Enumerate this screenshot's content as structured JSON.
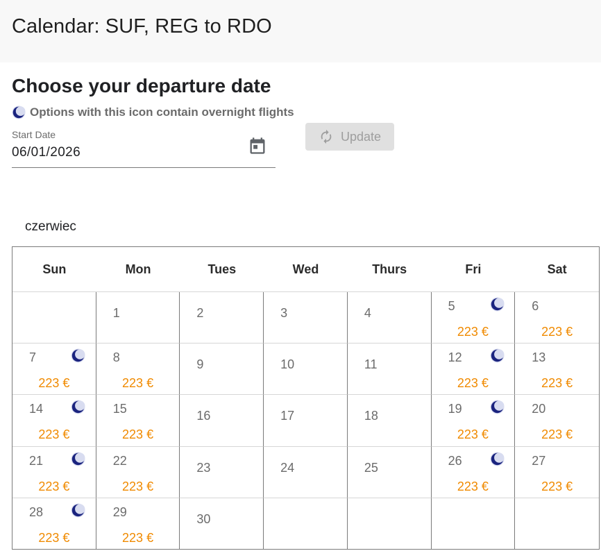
{
  "header": {
    "title": "Calendar: SUF, REG to RDO"
  },
  "page": {
    "heading": "Choose your departure date",
    "overnight_note": "Options with this icon contain overnight flights"
  },
  "start_date": {
    "label": "Start Date",
    "value": "06/01/2026"
  },
  "update_button": {
    "label": "Update"
  },
  "calendar": {
    "month": "czerwiec",
    "weekdays": [
      "Sun",
      "Mon",
      "Tues",
      "Wed",
      "Thurs",
      "Fri",
      "Sat"
    ],
    "days": [
      {
        "day": "",
        "price": "",
        "overnight": false
      },
      {
        "day": "1",
        "price": "",
        "overnight": false
      },
      {
        "day": "2",
        "price": "",
        "overnight": false
      },
      {
        "day": "3",
        "price": "",
        "overnight": false
      },
      {
        "day": "4",
        "price": "",
        "overnight": false
      },
      {
        "day": "5",
        "price": "223 €",
        "overnight": true
      },
      {
        "day": "6",
        "price": "223 €",
        "overnight": false
      },
      {
        "day": "7",
        "price": "223 €",
        "overnight": true
      },
      {
        "day": "8",
        "price": "223 €",
        "overnight": false
      },
      {
        "day": "9",
        "price": "",
        "overnight": false
      },
      {
        "day": "10",
        "price": "",
        "overnight": false
      },
      {
        "day": "11",
        "price": "",
        "overnight": false
      },
      {
        "day": "12",
        "price": "223 €",
        "overnight": true
      },
      {
        "day": "13",
        "price": "223 €",
        "overnight": false
      },
      {
        "day": "14",
        "price": "223 €",
        "overnight": true
      },
      {
        "day": "15",
        "price": "223 €",
        "overnight": false
      },
      {
        "day": "16",
        "price": "",
        "overnight": false
      },
      {
        "day": "17",
        "price": "",
        "overnight": false
      },
      {
        "day": "18",
        "price": "",
        "overnight": false
      },
      {
        "day": "19",
        "price": "223 €",
        "overnight": true
      },
      {
        "day": "20",
        "price": "223 €",
        "overnight": false
      },
      {
        "day": "21",
        "price": "223 €",
        "overnight": true
      },
      {
        "day": "22",
        "price": "223 €",
        "overnight": false
      },
      {
        "day": "23",
        "price": "",
        "overnight": false
      },
      {
        "day": "24",
        "price": "",
        "overnight": false
      },
      {
        "day": "25",
        "price": "",
        "overnight": false
      },
      {
        "day": "26",
        "price": "223 €",
        "overnight": true
      },
      {
        "day": "27",
        "price": "223 €",
        "overnight": false
      },
      {
        "day": "28",
        "price": "223 €",
        "overnight": true
      },
      {
        "day": "29",
        "price": "223 €",
        "overnight": false
      },
      {
        "day": "30",
        "price": "",
        "overnight": false
      },
      {
        "day": "",
        "price": "",
        "overnight": false
      },
      {
        "day": "",
        "price": "",
        "overnight": false
      },
      {
        "day": "",
        "price": "",
        "overnight": false
      },
      {
        "day": "",
        "price": "",
        "overnight": false
      }
    ]
  },
  "colors": {
    "price": "#f08a00",
    "moon": "#1a237e",
    "header_bg": "#f8f8f8"
  },
  "icons": {
    "overnight": "moon-icon",
    "calendar": "calendar-icon",
    "update": "refresh-icon"
  }
}
